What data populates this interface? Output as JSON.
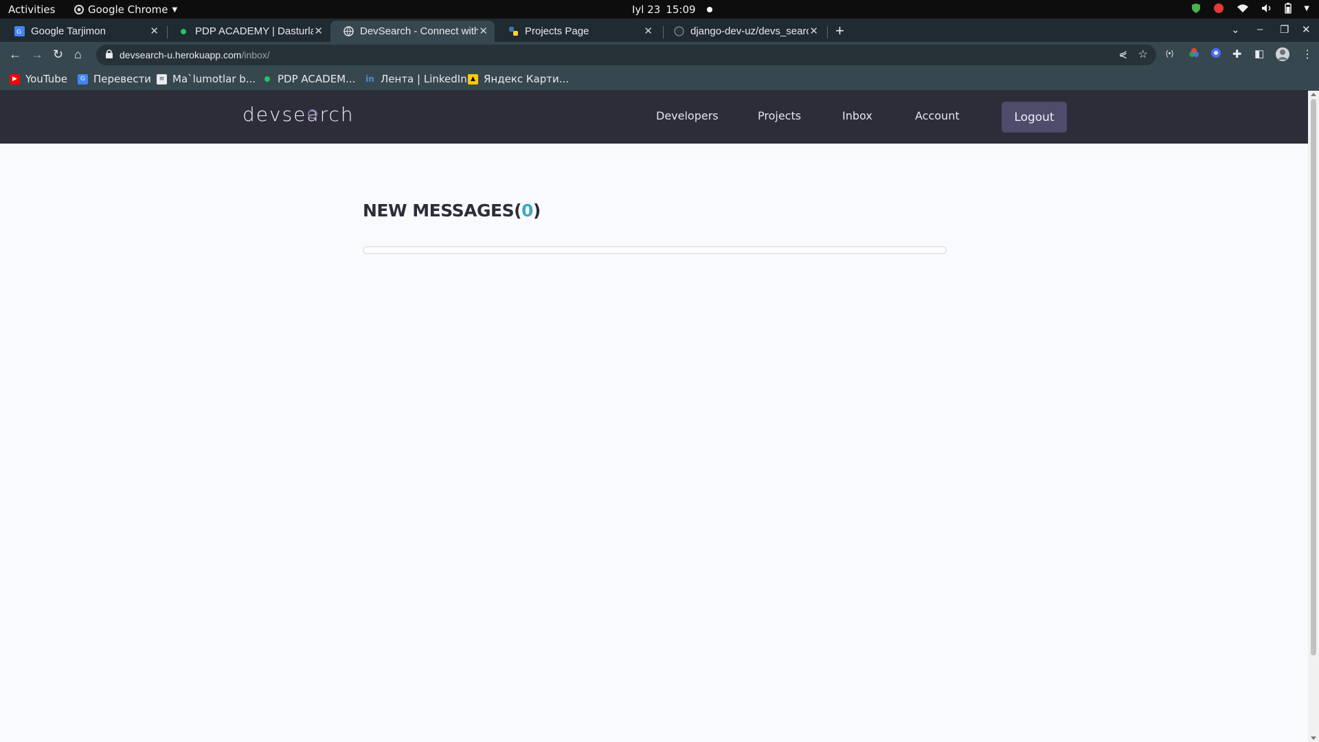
{
  "system": {
    "activities": "Activities",
    "app_name": "Google Chrome",
    "clock_date": "Iyl 23",
    "clock_time": "15:09"
  },
  "tabs": [
    {
      "title": "Google Tarjimon",
      "icon": "google-translate-icon"
    },
    {
      "title": "PDP ACADEMY | Dasturlash",
      "icon": "green-dot-icon"
    },
    {
      "title": "DevSearch - Connect with",
      "icon": "globe-icon",
      "active": true
    },
    {
      "title": "Projects Page",
      "icon": "python-icon"
    },
    {
      "title": "django-dev-uz/devs_search",
      "icon": "github-icon"
    }
  ],
  "address": {
    "host": "devsearch-u.herokuapp.com",
    "path": "/inbox/"
  },
  "bookmarks": [
    {
      "label": "YouTube",
      "icon": "youtube-icon",
      "color": "#ff0000"
    },
    {
      "label": "Перевести",
      "icon": "google-translate-icon",
      "color": "#4285f4"
    },
    {
      "label": "Ma`lumotlar b...",
      "icon": "document-icon",
      "color": "#e8eaed"
    },
    {
      "label": "PDP ACADEM...",
      "icon": "green-dot-icon",
      "color": "#22c55e"
    },
    {
      "label": "Лента | LinkedIn",
      "icon": "linkedin-icon",
      "color": "#0a66c2"
    },
    {
      "label": "Яндекс Карти...",
      "icon": "yandex-images-icon",
      "color": "#ffcc00"
    }
  ],
  "site": {
    "logo_start": "devse",
    "logo_mag": "a",
    "logo_end": "rch",
    "nav": [
      "Developers",
      "Projects",
      "Inbox",
      "Account"
    ],
    "logout": "Logout",
    "title_prefix": "NEW MESSAGES(",
    "unread_count": "0",
    "title_suffix": ")",
    "accent_color": "#3fa7c4",
    "header_color": "#2d2d39"
  }
}
